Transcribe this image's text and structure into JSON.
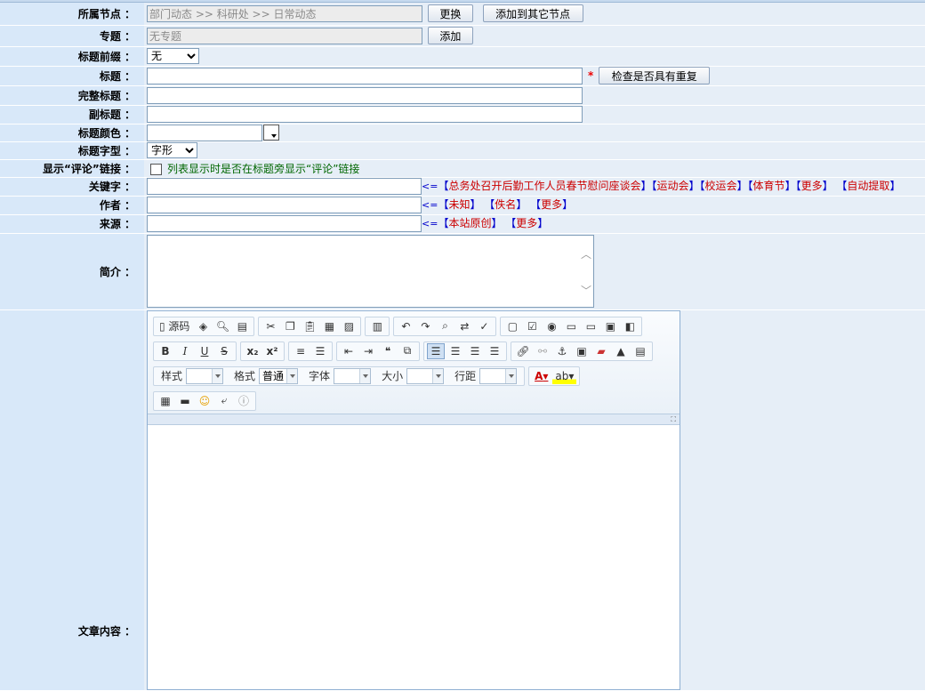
{
  "fields": {
    "node": {
      "label": "所属节点 ：",
      "value": "部门动态 >> 科研处 >> 日常动态",
      "change_btn": "更换",
      "add_other_btn": "添加到其它节点"
    },
    "topic": {
      "label": "专题 ：",
      "value": "无专题",
      "add_btn": "添加"
    },
    "prefix": {
      "label": "标题前缀 ：",
      "selected": "无"
    },
    "title": {
      "label": "标题 ：",
      "value": "",
      "required_mark": "*",
      "check_btn": "检查是否具有重复"
    },
    "full_title": {
      "label": "完整标题 ：",
      "value": ""
    },
    "subtitle": {
      "label": "副标题 ：",
      "value": ""
    },
    "title_color": {
      "label": "标题颜色 ：",
      "value": ""
    },
    "title_font": {
      "label": "标题字型 ：",
      "selected": "字形"
    },
    "comment_link": {
      "label": "显示“评论”链接 ：",
      "checked": false,
      "hint": "列表显示时是否在标题旁显示“评论”链接"
    },
    "keywords": {
      "label": "关键字 ：",
      "value": "",
      "arrow": "<=",
      "links": [
        "总务处召开后勤工作人员春节慰问座谈会",
        "运动会",
        "校运会",
        "体育节",
        "更多",
        "自动提取"
      ]
    },
    "author": {
      "label": "作者 ：",
      "value": "",
      "arrow": "<=",
      "links": [
        "未知",
        "佚名",
        "更多"
      ]
    },
    "source": {
      "label": "来源 ：",
      "value": "",
      "arrow": "<=",
      "links": [
        "本站原创",
        "更多"
      ]
    },
    "summary": {
      "label": "简介 ：",
      "value": ""
    },
    "content": {
      "label": "文章内容 ："
    }
  },
  "editor": {
    "source_label": "源码",
    "style_label": "样式",
    "format_label": "格式",
    "format_value": "普通",
    "font_label": "字体",
    "size_label": "大小",
    "line_height_label": "行距",
    "bold": "B",
    "italic": "I",
    "underline": "U",
    "strike": "S",
    "subscript": "x₂",
    "superscript": "x²",
    "font_color_glyph": "A",
    "bg_color_glyph": "ab"
  },
  "colors": {
    "label_bg": "#d8e8f9",
    "value_bg": "#e6eef7",
    "link": "#cc0000",
    "bracket": "#0000cc",
    "hint": "#006600"
  }
}
